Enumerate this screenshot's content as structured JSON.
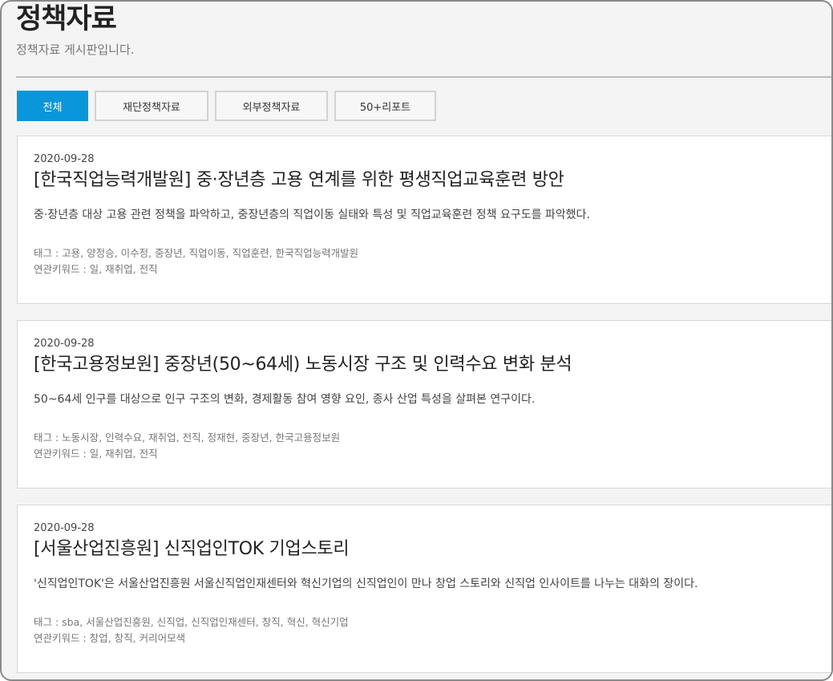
{
  "header": {
    "title": "정책자료",
    "subtitle": "정책자료 게시판입니다."
  },
  "tabs": [
    {
      "label": "전체",
      "active": true
    },
    {
      "label": "재단정책자료",
      "active": false
    },
    {
      "label": "외부정책자료",
      "active": false
    },
    {
      "label": "50+리포트",
      "active": false
    }
  ],
  "posts": [
    {
      "date": "2020-09-28",
      "title": "[한국직업능력개발원] 중·장년층 고용 연계를 위한 평생직업교육훈련 방안",
      "summary": "중·장년층 대상 고용 관련 정책을 파악하고, 중장년층의 직업이동 실태와 특성 및 직업교육훈련 정책 요구도를 파악했다.",
      "tags_label": "태그 :",
      "tags": [
        "고용",
        "양정승",
        "이수정",
        "중장년",
        "직업이동",
        "직업훈련",
        "한국직업능력개발원"
      ],
      "keywords_label": "연관키워드 :",
      "keywords": [
        "일",
        "재취업",
        "전직"
      ]
    },
    {
      "date": "2020-09-28",
      "title": "[한국고용정보원] 중장년(50~64세) 노동시장 구조 및 인력수요 변화 분석",
      "summary": "50~64세 인구를 대상으로 인구 구조의 변화, 경제활동 참여 영향 요인, 종사 산업 특성을 살펴본 연구이다.",
      "tags_label": "태그 :",
      "tags": [
        "노동시장",
        "인력수요",
        "재취업",
        "전직",
        "정재현",
        "중장년",
        "한국고용정보원"
      ],
      "keywords_label": "연관키워드 :",
      "keywords": [
        "일",
        "재취업",
        "전직"
      ]
    },
    {
      "date": "2020-09-28",
      "title": "[서울산업진흥원] 신직업인TOK 기업스토리",
      "summary": "'신직업인TOK'은 서울산업진흥원 서울신직업인재센터와 혁신기업의 신직업인이 만나 창업 스토리와 신직업 인사이트를 나누는 대화의 장이다.",
      "tags_label": "태그 :",
      "tags": [
        "sba",
        "서울산업진흥원",
        "신직업",
        "신직업인재센터",
        "창직",
        "혁신",
        "혁신기업"
      ],
      "keywords_label": "연관키워드 :",
      "keywords": [
        "창업",
        "창직",
        "커리어모색"
      ]
    }
  ],
  "colors": {
    "accent": "#0a97d9",
    "background": "#f4f4f4",
    "card": "#ffffff"
  }
}
